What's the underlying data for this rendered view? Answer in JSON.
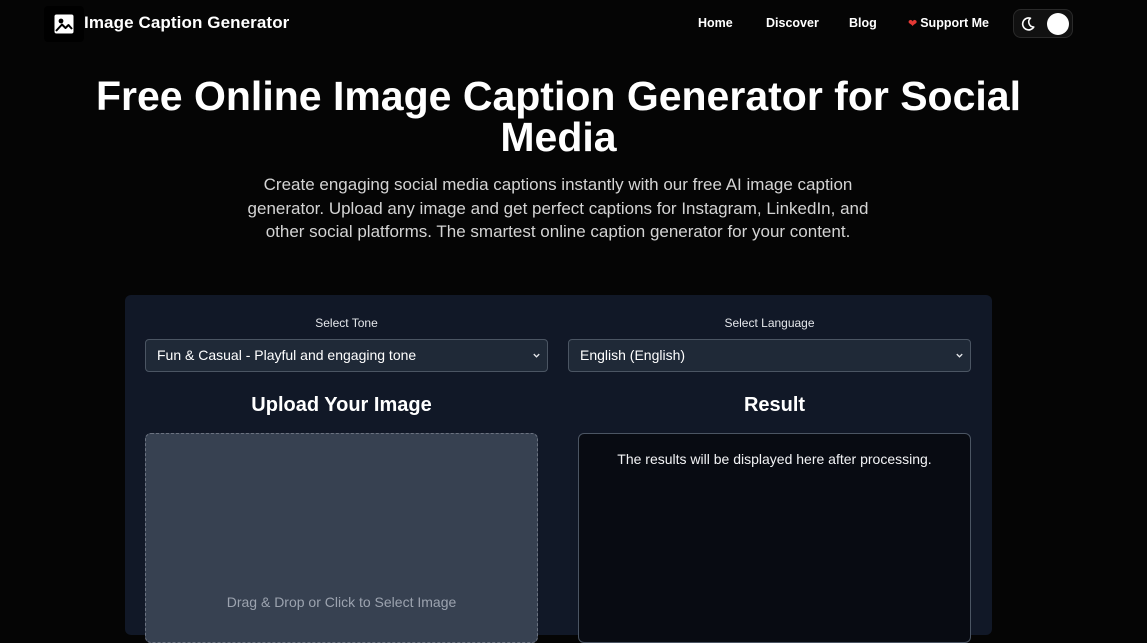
{
  "header": {
    "brand": "Image Caption Generator",
    "logo_icon": "image-icon",
    "nav": {
      "home": "Home",
      "discover": "Discover",
      "blog": "Blog",
      "support": "Support Me",
      "support_icon": "heart-icon"
    },
    "theme_toggle": {
      "icon": "moon-icon",
      "state": "dark"
    }
  },
  "hero": {
    "title": "Free Online Image Caption Generator for Social Media",
    "subtitle": "Create engaging social media captions instantly with our free AI image caption generator. Upload any image and get perfect captions for Instagram, LinkedIn, and other social platforms. The smartest online caption generator for your content."
  },
  "form": {
    "tone_label": "Select Tone",
    "tone_value": "Fun & Casual - Playful and engaging tone",
    "language_label": "Select Language",
    "language_value": "English (English)"
  },
  "upload": {
    "title": "Upload Your Image",
    "dropzone_text": "Drag & Drop or Click to Select Image"
  },
  "result": {
    "title": "Result",
    "placeholder": "The results will be displayed here after processing."
  },
  "colors": {
    "page_bg": "#050505",
    "card_bg": "#111827",
    "select_bg": "#1f2937",
    "dropzone_bg": "#374151",
    "result_bg": "#080b12",
    "heart": "#e53935"
  }
}
